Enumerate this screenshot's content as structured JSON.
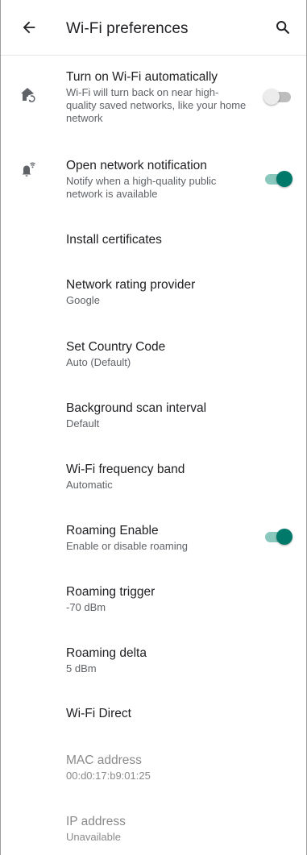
{
  "header": {
    "title": "Wi-Fi preferences"
  },
  "preferences": [
    {
      "title": "Turn on Wi-Fi automatically",
      "summary": "Wi-Fi will turn back on near high-quality saved networks, like your home network",
      "toggle": "off"
    },
    {
      "title": "Open network notification",
      "summary": "Notify when a high-quality public network is available",
      "toggle": "on"
    },
    {
      "title": "Install certificates"
    },
    {
      "title": "Network rating provider",
      "summary": "Google"
    },
    {
      "title": "Set Country Code",
      "summary": "Auto (Default)"
    },
    {
      "title": "Background scan interval",
      "summary": "Default"
    },
    {
      "title": "Wi-Fi frequency band",
      "summary": "Automatic"
    },
    {
      "title": "Roaming Enable",
      "summary": "Enable or disable roaming",
      "toggle": "on"
    },
    {
      "title": "Roaming trigger",
      "summary": "-70 dBm"
    },
    {
      "title": "Roaming delta",
      "summary": "5 dBm"
    },
    {
      "title": "Wi-Fi Direct"
    },
    {
      "title": "MAC address",
      "summary": "00:d0:17:b9:01:25",
      "disabled": true
    },
    {
      "title": "IP address",
      "summary": "Unavailable",
      "disabled": true
    }
  ],
  "icons": {
    "back": "arrow-back-icon",
    "search": "search-icon",
    "home_wifi": "home-auto-icon",
    "notification_wifi": "bell-wifi-icon"
  },
  "colors": {
    "accent": "#00796b",
    "accent_track": "#8ac7bd",
    "switch_off_track": "#bdbdbd",
    "switch_off_thumb": "#ececec",
    "icon": "#5f6368"
  }
}
